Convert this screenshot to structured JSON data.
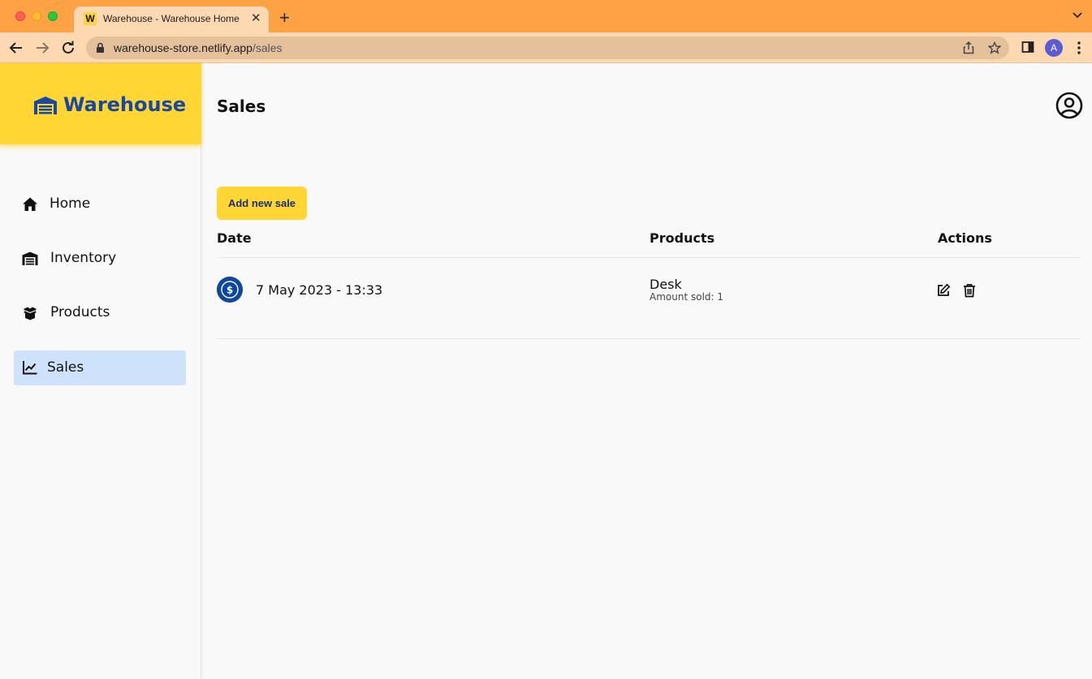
{
  "browser": {
    "tab_favicon": "W",
    "tab_title": "Warehouse - Warehouse Home",
    "url_host": "warehouse-store.netlify.app",
    "url_path": "/sales",
    "profile_initial": "A",
    "colors": {
      "titlebar": "#ffa245",
      "toolbar": "#fed8b1"
    }
  },
  "brand": {
    "name": "Warehouse",
    "icon": "warehouse-icon",
    "color": "#1a48a0",
    "background": "#ffd633"
  },
  "sidebar": {
    "items": [
      {
        "label": "Home",
        "icon": "home-icon"
      },
      {
        "label": "Inventory",
        "icon": "warehouse-icon"
      },
      {
        "label": "Products",
        "icon": "boxes-icon"
      },
      {
        "label": "Sales",
        "icon": "chart-line-icon",
        "active": true
      }
    ],
    "active_color": "#cfe2fc"
  },
  "page": {
    "title": "Sales",
    "add_button": "Add new sale",
    "table": {
      "headers": [
        "Date",
        "Products",
        "Actions"
      ],
      "rows": [
        {
          "date": "7 May 2023 - 13:33",
          "product": "Desk",
          "amount": "Amount sold: 1",
          "icon": "dollar-coin-icon"
        }
      ]
    }
  }
}
